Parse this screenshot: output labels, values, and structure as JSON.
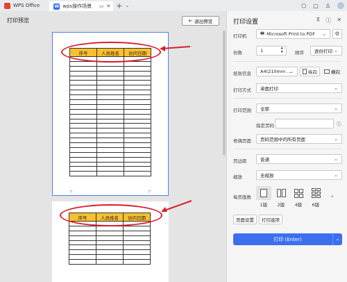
{
  "titlebar": {
    "app_name": "WPS Office",
    "doc_tab": "wps操作场景",
    "plus": "+"
  },
  "preview": {
    "title": "打印预览",
    "exit_button": "退出预览",
    "table_headers": [
      "序号",
      "人员姓名",
      "访问日期"
    ],
    "page1_rows": 25,
    "page2_rows": 9
  },
  "settings": {
    "title": "打印设置",
    "printer_label": "打印机",
    "printer_value": "Microsoft Print to PDF",
    "copies_label": "份数",
    "copies_value": "1",
    "order_label": "顺序",
    "order_value": "逐份打印",
    "paper_label": "纸张信息",
    "paper_value": "A4(210mm ...",
    "portrait": "纵向",
    "landscape": "横向",
    "print_mode_label": "打印方式",
    "print_mode_value": "单面打印",
    "range_label": "打印范围",
    "range_value": "全部",
    "specify_label": "指定页码",
    "specify_value": "",
    "odd_even_label": "奇偶页面",
    "odd_even_value": "页码范围中的所有页面",
    "margin_label": "页边距",
    "margin_value": "普通",
    "scale_label": "缩放",
    "scale_value": "无缩放",
    "pps_label": "每页版数",
    "pps_options": [
      "1版",
      "2版",
      "4版",
      "6版"
    ],
    "pps_selected": "1版",
    "page_setup": "页面设置",
    "print_options": "打印选项",
    "print_button": "打印 (Enter)"
  },
  "colors": {
    "header_fill": "#fbc02d",
    "annotation_red": "#d81e2c",
    "print_blue": "#3c6ff0",
    "page_selected_border": "#4d7ee8"
  },
  "icons": [
    "wps-logo-icon",
    "doc-logo-icon",
    "monitor-icon",
    "close-icon",
    "plus-icon",
    "cube-icon",
    "box-icon",
    "shirt-icon",
    "avatar",
    "exit-preview-icon",
    "pin-icon",
    "info-icon",
    "close-panel-icon",
    "chevron-down-icon",
    "printer-settings-icon"
  ]
}
